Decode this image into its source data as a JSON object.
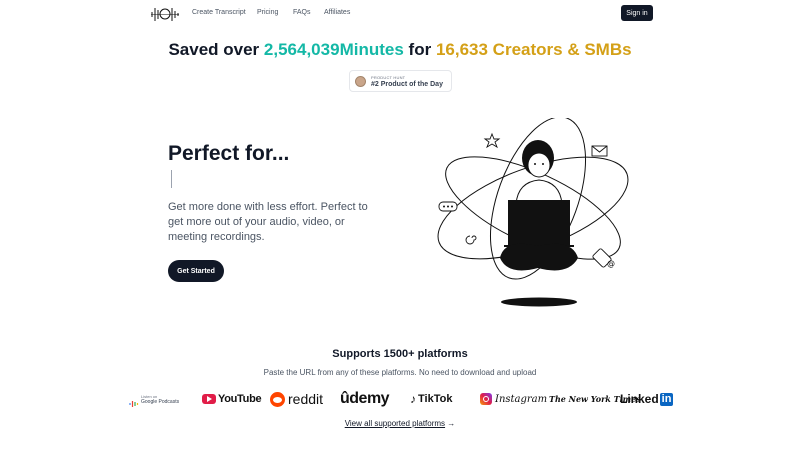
{
  "nav": {
    "links": [
      "Create Transcript",
      "Pricing",
      "FAQs",
      "Affiliates"
    ],
    "signin": "Sign in"
  },
  "hero": {
    "stat_prefix": "Saved over",
    "minutes_value": "2,564,039",
    "minutes_label": "Minutes",
    "stat_for": "for",
    "creators_value": "16,633",
    "creators_label": "Creators & SMBs",
    "badge_small": "PRODUCT HUNT",
    "badge_big": "#2 Product of the Day",
    "headline": "Perfect for...",
    "subtitle": "Get more done with less effort. Perfect to get more out of your audio, video, or meeting recordings.",
    "cta": "Get Started"
  },
  "platforms": {
    "title": "Supports 1500+ platforms",
    "subtitle": "Paste the URL from any of these platforms. No need to download and upload",
    "logos": {
      "gp_small": "Listen on",
      "gp_name": "Google Podcasts",
      "youtube": "YouTube",
      "reddit": "reddit",
      "udemy": "ûdemy",
      "tiktok": "TikTok",
      "instagram": "Instagram",
      "nyt": "The New York Times",
      "linked": "Linked",
      "in": "in"
    },
    "view_all": "View all supported platforms",
    "view_all_arrow": "→"
  },
  "colors": {
    "teal": "#14b8a6",
    "gold": "#d4a017",
    "dark": "#111827"
  }
}
